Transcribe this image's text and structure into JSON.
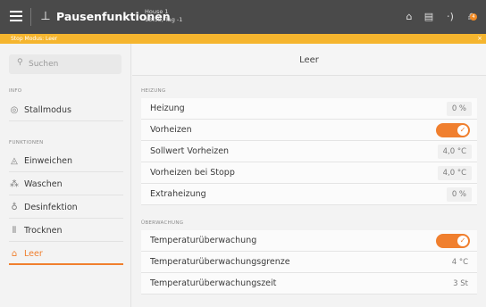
{
  "topbar": {
    "title": "Pausenfunktionen",
    "house_name": "House 1",
    "house_time": "13:38, Tag -1",
    "menu_icon": "hamburger-icon",
    "function_icon": "pause-function-icon",
    "icons": [
      "home-icon",
      "document-icon",
      "signal-icon",
      "bell-icon"
    ],
    "notification_count": "4"
  },
  "status_strip": {
    "text": "Stop Modus: Leer",
    "close": "×",
    "color": "#f5b52e"
  },
  "sidebar": {
    "search_placeholder": "Suchen",
    "sections": [
      {
        "label": "INFO",
        "items": [
          {
            "label": "Stallmodus",
            "icon": "stall-mode-icon"
          }
        ]
      },
      {
        "label": "FUNKTIONEN",
        "items": [
          {
            "label": "Einweichen",
            "icon": "soak-icon"
          },
          {
            "label": "Waschen",
            "icon": "wash-icon"
          },
          {
            "label": "Desinfektion",
            "icon": "disinfection-icon"
          },
          {
            "label": "Trocknen",
            "icon": "dry-icon"
          },
          {
            "label": "Leer",
            "icon": "empty-icon",
            "active": true
          }
        ]
      }
    ]
  },
  "main": {
    "title": "Leer",
    "groups": [
      {
        "label": "HEIZUNG",
        "rows": [
          {
            "label": "Heizung",
            "value": "0 %"
          },
          {
            "label": "Vorheizen",
            "toggle": true
          },
          {
            "label": "Sollwert Vorheizen",
            "value": "4,0 °C"
          },
          {
            "label": "Vorheizen bei Stopp",
            "value": "4,0 °C"
          },
          {
            "label": "Extraheizung",
            "value": "0 %"
          }
        ]
      },
      {
        "label": "ÜBERWACHUNG",
        "rows": [
          {
            "label": "Temperaturüberwachung",
            "toggle": true
          },
          {
            "label": "Temperaturüberwachungsgrenze",
            "value": "4 °C"
          },
          {
            "label": "Temperaturüberwachungszeit",
            "value": "3 St"
          }
        ]
      }
    ]
  },
  "colors": {
    "accent": "#f07f2e",
    "topbar": "#4a4a4a",
    "strip": "#f5b52e"
  }
}
